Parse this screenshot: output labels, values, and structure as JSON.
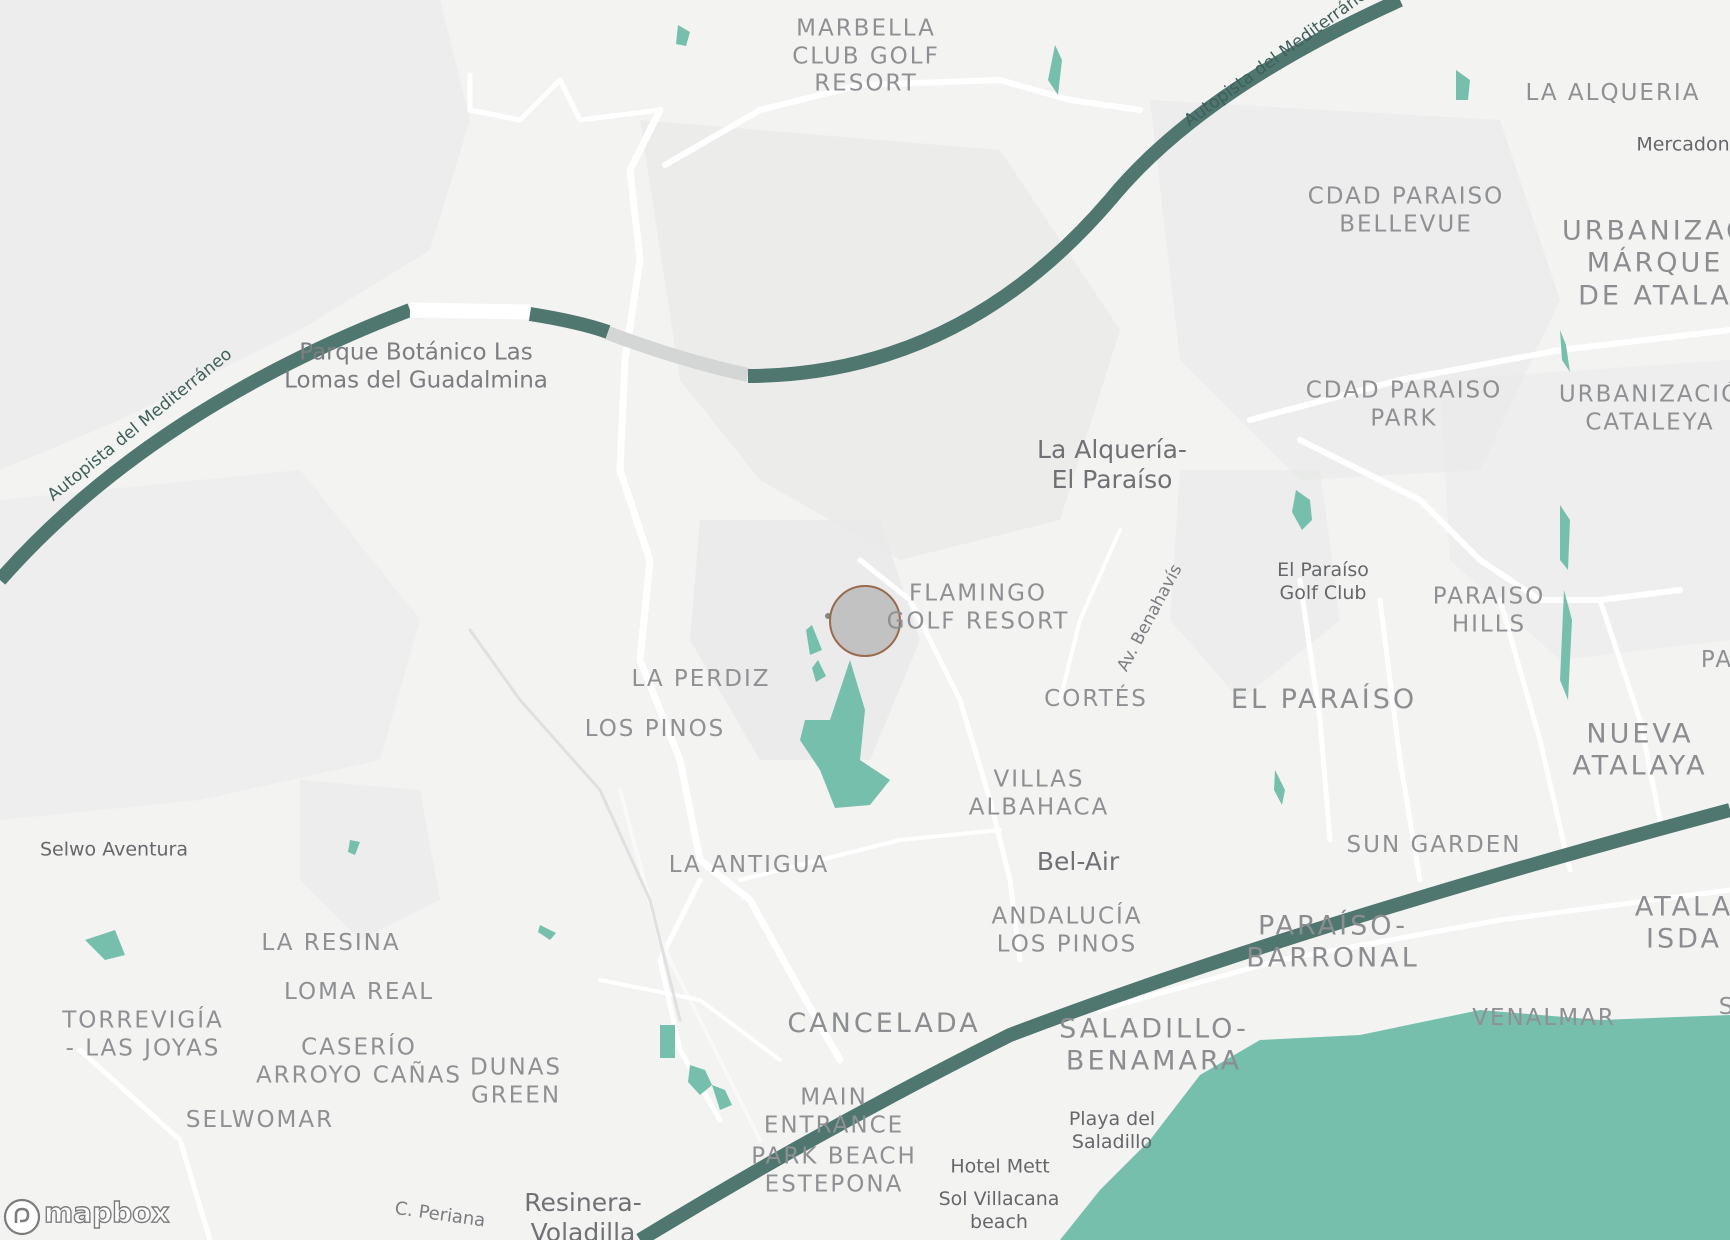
{
  "map": {
    "colors": {
      "land": "#f3f3f2",
      "terrain": "#e7e8e7",
      "water": "#76bfad",
      "motorway": "#4f766f",
      "road": "#ffffff",
      "marker_fill": "#a0a0a3",
      "marker_stroke": "#9a6a4d"
    },
    "labels": {
      "marbella_club": "MARBELLA\nCLUB GOLF\nRESORT",
      "la_alqueria_top": "LA ALQUERIA",
      "mercadona": "Mercadon",
      "cdad_bellevue": "CDAD PARAISO\nBELLEVUE",
      "urb_marques": "URBANIZAC\nMÁRQUE\nDE ATALA",
      "parque_botanico": "Parque Botánico Las\nLomas del Guadalmina",
      "cdad_park": "CDAD PARAISO\nPARK",
      "urb_cataleya": "URBANIZACIÓ\nCATALEYA",
      "alqueria_paraiso": "La Alquería-\nEl Paraíso",
      "flamingo": "FLAMINGO\nGOLF RESORT",
      "paraiso_golf": "El Paraíso\nGolf Club",
      "paraiso_hills": "PARAISO\nHILLS",
      "pa": "PA",
      "la_perdiz": "LA PERDIZ",
      "cortes": "CORTÉS",
      "el_paraiso": "EL PARAÍSO",
      "los_pinos": "LOS PINOS",
      "nueva_atalaya": "NUEVA\nATALAYA",
      "villas_albahaca": "VILLAS\nALBAHACA",
      "sun_garden": "SUN GARDEN",
      "selwo_aventura": "Selwo Aventura",
      "la_antigua": "LA ANTIGUA",
      "bel_air": "Bel-Air",
      "andalucia_pinos": "ANDALUCÍA\nLOS PINOS",
      "paraiso_barronal": "PARAÍSO-\nBARRONAL",
      "atala_isda": "ATALA\nISDA",
      "la_resina": "LA RESINA",
      "loma_real": "LOMA REAL",
      "torreviga": "TORREVIGÍA\n- LAS JOYAS",
      "caserio": "CASERÍO\nARROYO CAÑAS",
      "dunas_green": "DUNAS\nGREEN",
      "cancelada": "CANCELADA",
      "saladillo": "SALADILLO-\nBENAMARA",
      "venalmar": "VENALMAR",
      "selwomar": "SELWOMAR",
      "main_entrance": "MAIN\nENTRANCE",
      "park_beach": "PARK BEACH\nESTEPONA",
      "playa_saladillo": "Playa del\nSaladillo",
      "hotel_mett": "Hotel Mett",
      "sol_villacana": "Sol Villacana\nbeach",
      "resinera": "Resinera-\nVoladilla",
      "c_periana": "C. Periana",
      "s_edge": "S"
    },
    "roads": {
      "autopista_left": "Autopista del Mediterráneo",
      "autopista_right": "Autopista del Mediterráneo",
      "av_benahavis": "Av. Benahavís"
    },
    "logo": "mapbox",
    "marker_icon": "location-circle"
  }
}
